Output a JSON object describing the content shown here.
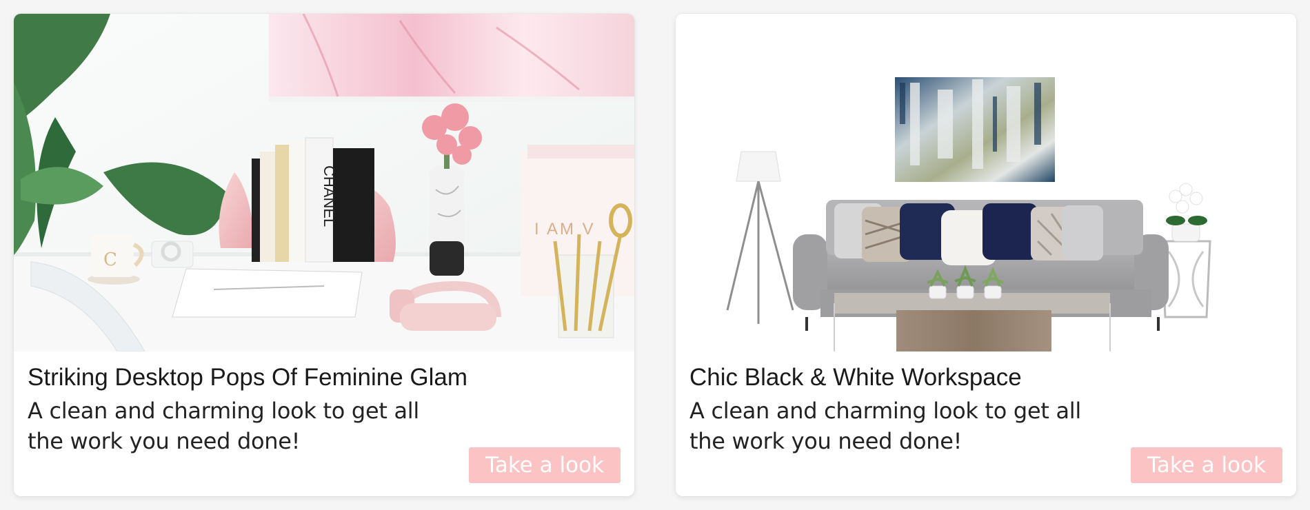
{
  "cards": [
    {
      "title": "Striking Desktop Pops Of Feminine Glam",
      "description": "A clean and charming look to get all the work you need done!",
      "button_label": "Take a look",
      "image": "photo of white desk with pink flowers, books, plant and pink headphones"
    },
    {
      "title": "Chic Black & White Workspace",
      "description": "A clean and charming look to get all the work you need done!",
      "button_label": "Take a look",
      "image": "mood board with grey sofa, abstract painting, floor lamp, coffee table and side table"
    }
  ],
  "colors": {
    "button_bg": "#fbc3c4",
    "button_text": "#ffffff",
    "card_bg": "#ffffff",
    "page_bg": "#f5f5f5"
  }
}
